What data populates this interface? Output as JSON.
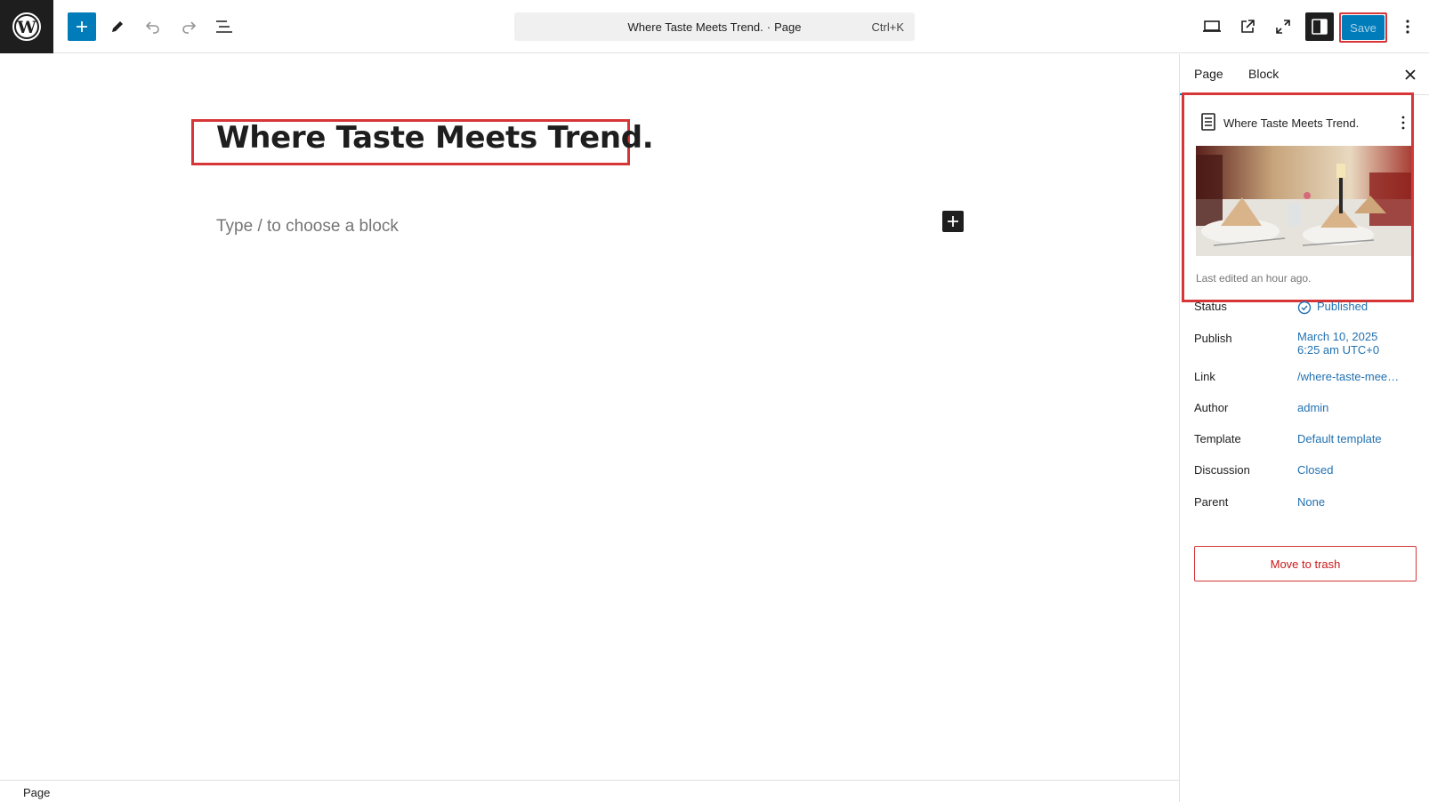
{
  "toolbar": {
    "command_title": "Where Taste Meets Trend.",
    "command_sep": "·",
    "command_type": "Page",
    "command_shortcut": "Ctrl+K",
    "save_label": "Save"
  },
  "editor": {
    "post_title": "Where Taste Meets Trend.",
    "block_placeholder": "Type / to choose a block"
  },
  "footer": {
    "breadcrumb": "Page"
  },
  "sidebar": {
    "tabs": [
      {
        "label": "Page",
        "active": true
      },
      {
        "label": "Block",
        "active": false
      }
    ],
    "summary": {
      "title": "Where Taste Meets Trend.",
      "last_edited": "Last edited an hour ago."
    },
    "meta": {
      "status": {
        "label": "Status",
        "value": "Published"
      },
      "publish": {
        "label": "Publish",
        "value_line1": "March 10, 2025",
        "value_line2": "6:25 am UTC+0"
      },
      "link": {
        "label": "Link",
        "value": "/where-taste-mee…"
      },
      "author": {
        "label": "Author",
        "value": "admin"
      },
      "template": {
        "label": "Template",
        "value": "Default template"
      },
      "discussion": {
        "label": "Discussion",
        "value": "Closed"
      },
      "parent": {
        "label": "Parent",
        "value": "None"
      }
    },
    "trash_label": "Move to trash"
  },
  "colors": {
    "accent": "#007cba",
    "link": "#2271b1",
    "danger": "#d63638",
    "dark": "#1e1e1e"
  },
  "icons": [
    "wordpress-icon",
    "plus-icon",
    "pencil-icon",
    "undo-icon",
    "redo-icon",
    "list-view-icon",
    "desktop-preview-icon",
    "external-link-icon",
    "fullscreen-icon",
    "sidebar-icon",
    "kebab-menu-icon",
    "close-icon",
    "document-icon",
    "check-circle-icon"
  ]
}
